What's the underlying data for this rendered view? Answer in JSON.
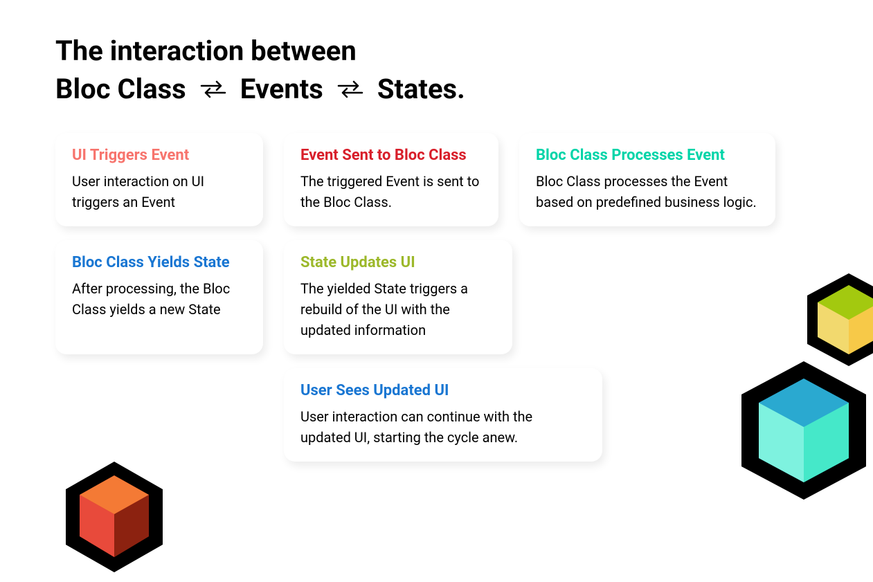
{
  "title": {
    "line1": "The interaction between",
    "part1": "Bloc Class",
    "part2": "Events",
    "part3": "States."
  },
  "cards": [
    {
      "title": "UI Triggers Event",
      "body": "User interaction on UI triggers an Event"
    },
    {
      "title": "Event Sent to Bloc Class",
      "body": "The triggered Event is sent to the Bloc Class."
    },
    {
      "title": "Bloc Class Processes Event",
      "body": "Bloc Class processes the Event based on predefined business logic."
    },
    {
      "title": "Bloc Class Yields State",
      "body": "After processing, the Bloc Class yields a new State"
    },
    {
      "title": "State Updates UI",
      "body": "The yielded State triggers a rebuild of the UI with the updated information"
    },
    {
      "title": "User Sees Updated UI",
      "body": "User interaction can continue with the updated UI, starting the cycle anew."
    }
  ]
}
